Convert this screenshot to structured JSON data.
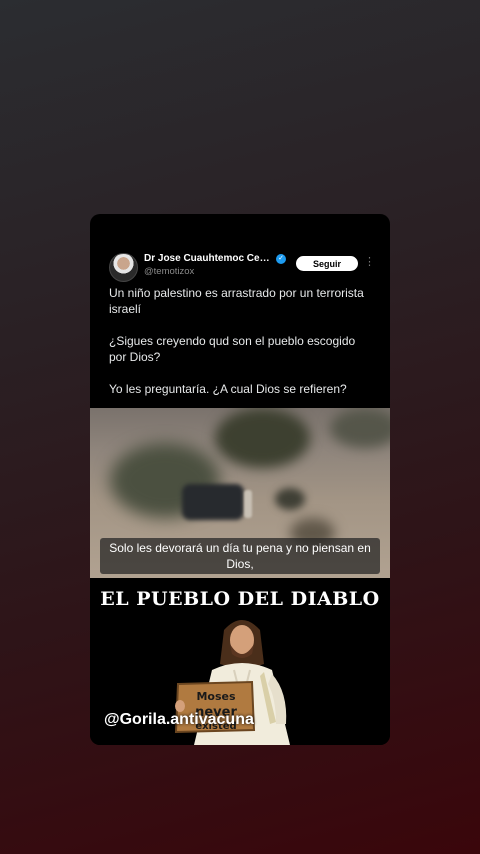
{
  "tweet": {
    "author_name": "Dr Jose Cuauhtemoc Cer…",
    "handle": "@temotizox",
    "follow_label": "Seguir",
    "more_label": "⋮",
    "paragraphs": [
      "Un niño palestino es arrastrado por un terrorista israelí",
      "¿Sigues creyendo qud son el pueblo escogido por Dios?",
      "Yo les preguntaría. ¿A cual Dios se refieren?"
    ]
  },
  "video": {
    "subtitle": "Solo les devorará un día tu pena y no piensan en Dios,"
  },
  "banner": {
    "title": "EL PUEBLO DEL DIABLO",
    "sign_text": "Moses never existed",
    "watermark": "@Gorila.antivacuna"
  },
  "colors": {
    "verified": "#1d9bf0",
    "card_bg": "#000000"
  }
}
